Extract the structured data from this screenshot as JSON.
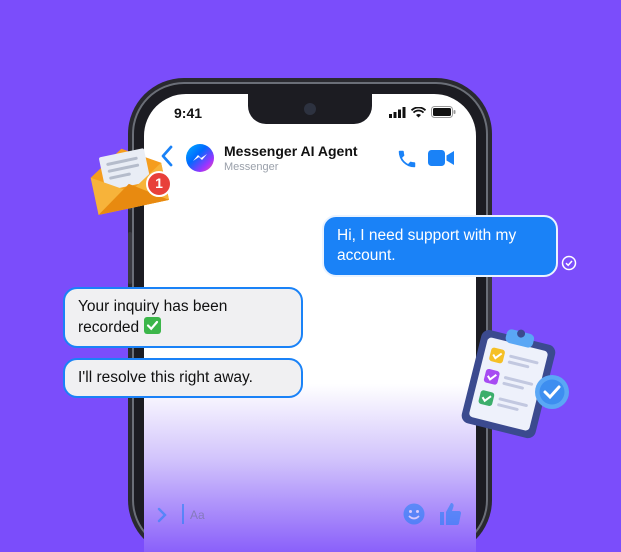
{
  "status": {
    "time": "9:41"
  },
  "header": {
    "title": "Messenger AI Agent",
    "subtitle": "Messenger"
  },
  "messages": {
    "sent": "Hi, I need support with my account.",
    "received_1": "Your inquiry has been recorded",
    "received_2": "I'll resolve this right away."
  },
  "notification": {
    "count": "1"
  },
  "composer": {
    "placeholder": "Aa"
  },
  "colors": {
    "background": "#7b4dfb",
    "accent": "#1a82f7",
    "badge": "#e8403a",
    "check": "#3cb64a"
  },
  "icons": [
    "back-chevron-icon",
    "messenger-logo-icon",
    "phone-icon",
    "video-icon",
    "envelope-icon",
    "checkmark-icon",
    "read-receipt-icon",
    "clipboard-icon",
    "verified-badge-icon",
    "emoji-icon",
    "thumbs-up-icon"
  ]
}
